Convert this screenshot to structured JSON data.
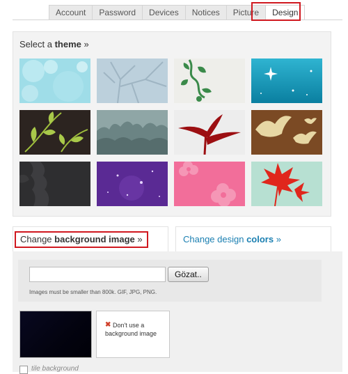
{
  "tabs": [
    {
      "label": "Account"
    },
    {
      "label": "Password"
    },
    {
      "label": "Devices"
    },
    {
      "label": "Notices"
    },
    {
      "label": "Picture"
    },
    {
      "label": "Design",
      "active": true
    }
  ],
  "theme_section": {
    "prefix": "Select a ",
    "bold": "theme",
    "suffix": " »"
  },
  "themes": [
    {
      "name": "light-blue-bubbles"
    },
    {
      "name": "grey-branches"
    },
    {
      "name": "green-vines"
    },
    {
      "name": "teal-sparkles"
    },
    {
      "name": "dark-brown-leaves"
    },
    {
      "name": "teal-grey-trees"
    },
    {
      "name": "red-plant-silhouette"
    },
    {
      "name": "brown-birds"
    },
    {
      "name": "dark-grey-pattern"
    },
    {
      "name": "purple-stars"
    },
    {
      "name": "pink-flowers"
    },
    {
      "name": "red-maple-mint"
    }
  ],
  "bg_tabs": {
    "left_prefix": "Change ",
    "left_bold": "background image",
    "left_suffix": " »",
    "right_prefix": "Change design ",
    "right_bold": "colors",
    "right_suffix": " »"
  },
  "upload": {
    "input_value": "",
    "button_label": "Gözat..",
    "hint": "Images must be smaller than 800k. GIF, JPG, PNG."
  },
  "no_background": {
    "label": "Don't use a background image"
  },
  "tile": {
    "label": "tile background",
    "checked": false
  },
  "colors": {
    "accent_link": "#1a7fb1",
    "highlight_box": "#d0181f"
  }
}
